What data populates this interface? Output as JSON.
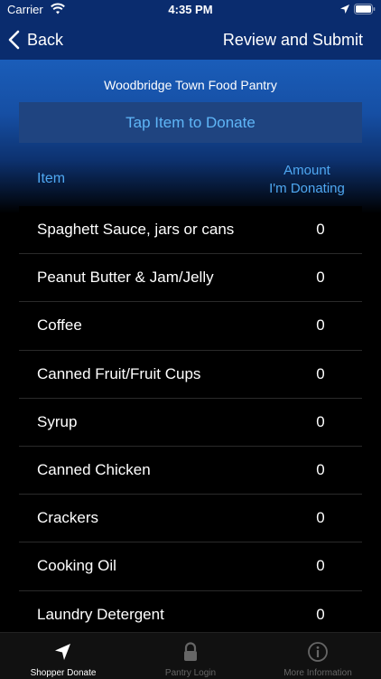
{
  "status_bar": {
    "carrier": "Carrier",
    "time": "4:35 PM"
  },
  "nav": {
    "back_label": "Back",
    "submit_label": "Review and Submit"
  },
  "pantry_name": "Woodbridge Town Food Pantry",
  "banner": "Tap Item to Donate",
  "columns": {
    "item": "Item",
    "amount_line1": "Amount",
    "amount_line2": "I'm Donating"
  },
  "items": [
    {
      "name": "Spaghett Sauce, jars or cans",
      "amount": "0"
    },
    {
      "name": "Peanut Butter & Jam/Jelly",
      "amount": "0"
    },
    {
      "name": "Coffee",
      "amount": "0"
    },
    {
      "name": "Canned Fruit/Fruit Cups",
      "amount": "0"
    },
    {
      "name": "Syrup",
      "amount": "0"
    },
    {
      "name": "Canned Chicken",
      "amount": "0"
    },
    {
      "name": "Crackers",
      "amount": "0"
    },
    {
      "name": "Cooking Oil",
      "amount": "0"
    },
    {
      "name": "Laundry Detergent",
      "amount": "0"
    }
  ],
  "tabs": [
    {
      "label": "Shopper Donate",
      "icon": "navigation-arrow-icon",
      "active": true
    },
    {
      "label": "Pantry Login",
      "icon": "lock-icon",
      "active": false
    },
    {
      "label": "More Information",
      "icon": "info-icon",
      "active": false
    }
  ],
  "colors": {
    "nav_bg": "#0a2c6e",
    "accent": "#4fa8f2",
    "banner_bg": "#1f4480"
  }
}
